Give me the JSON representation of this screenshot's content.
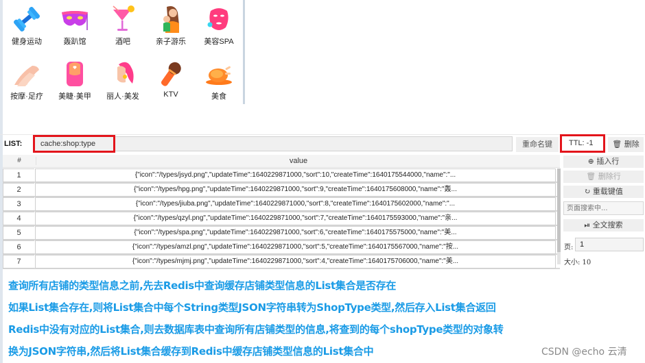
{
  "categories": [
    {
      "label": "健身运动",
      "icon": "dumbbell-icon"
    },
    {
      "label": "轰趴馆",
      "icon": "party-mask-icon"
    },
    {
      "label": "酒吧",
      "icon": "cocktail-icon"
    },
    {
      "label": "亲子游乐",
      "icon": "parent-child-icon"
    },
    {
      "label": "美容SPA",
      "icon": "face-mask-icon"
    },
    {
      "label": "按摩·足疗",
      "icon": "massage-hand-icon"
    },
    {
      "label": "美睫·美甲",
      "icon": "nail-icon"
    },
    {
      "label": "丽人·美发",
      "icon": "hair-icon"
    },
    {
      "label": "KTV",
      "icon": "microphone-icon"
    },
    {
      "label": "美食",
      "icon": "roast-chicken-icon"
    }
  ],
  "redis": {
    "list_label": "LIST:",
    "key": "cache:shop:type",
    "rename_label": "重命名键",
    "ttl_label": "TTL:  -1",
    "delete_label": "删除",
    "columns": {
      "num": "#",
      "value": "value"
    },
    "rows": [
      {
        "num": "1",
        "value": "{\"icon\":\"/types/jsyd.png\",\"updateTime\":1640229871000,\"sort\":10,\"createTime\":1640175544000,\"name\":\"..."
      },
      {
        "num": "2",
        "value": "{\"icon\":\"/types/hpg.png\",\"updateTime\":1640229871000,\"sort\":9,\"createTime\":1640175608000,\"name\":\"轰..."
      },
      {
        "num": "3",
        "value": "{\"icon\":\"/types/jiuba.png\",\"updateTime\":1640229871000,\"sort\":8,\"createTime\":1640175602000,\"name\":\"..."
      },
      {
        "num": "4",
        "value": "{\"icon\":\"/types/qzyl.png\",\"updateTime\":1640229871000,\"sort\":7,\"createTime\":1640175593000,\"name\":\"亲..."
      },
      {
        "num": "5",
        "value": "{\"icon\":\"/types/spa.png\",\"updateTime\":1640229871000,\"sort\":6,\"createTime\":1640175575000,\"name\":\"美..."
      },
      {
        "num": "6",
        "value": "{\"icon\":\"/types/amzl.png\",\"updateTime\":1640229871000,\"sort\":5,\"createTime\":1640175567000,\"name\":\"按..."
      },
      {
        "num": "7",
        "value": "{\"icon\":\"/types/mjmj.png\",\"updateTime\":1640229871000,\"sort\":4,\"createTime\":1640175706000,\"name\":\"美..."
      }
    ],
    "side": {
      "insert_row": "插入行",
      "delete_row": "删除行",
      "reload": "重载键值",
      "search_placeholder": "页面搜索中...",
      "fulltext_search": "全文搜索",
      "page_label": "页:",
      "page_value": "1",
      "size_label": "大小:  10"
    }
  },
  "description": [
    "查询所有店铺的类型信息之前,先去Redis中查询缓存店铺类型信息的List集合是否存在",
    "如果List集合存在,则将List集合中每个String类型JSON字符串转为ShopType类型,然后存入List集合返回",
    "Redis中没有对应的List集合,则去数据库表中查询所有店铺类型的信息,将查到的每个shopType类型的对象转",
    "换为JSON字符串,然后将List集合缓存到Redis中缓存店铺类型信息的List集合中"
  ],
  "watermark": "CSDN @echo 云清",
  "colors": {
    "highlight": "#e3141b",
    "description_text": "#1a9be6"
  }
}
